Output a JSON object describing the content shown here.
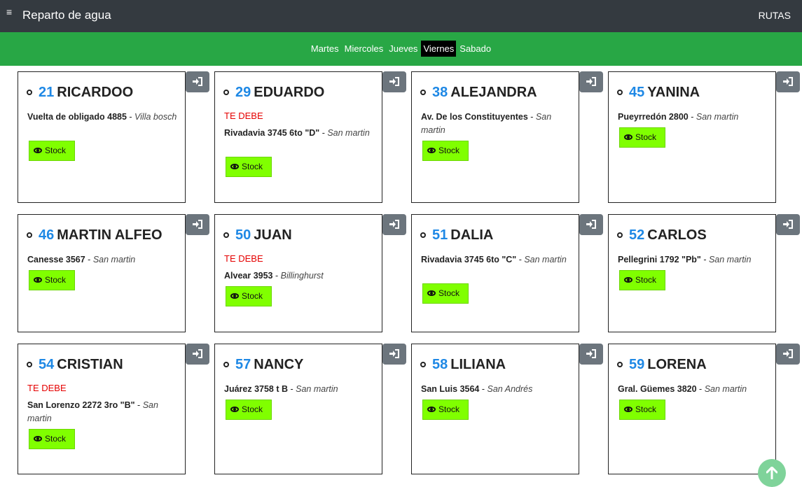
{
  "header": {
    "menu_icon": "hamburger-icon",
    "title": "Reparto de agua",
    "rutas_label": "RUTAS"
  },
  "days": {
    "items": [
      {
        "label": "Martes"
      },
      {
        "label": "Miercoles"
      },
      {
        "label": "Jueves"
      },
      {
        "label": "Viernes"
      },
      {
        "label": "Sabado"
      }
    ],
    "active": "Viernes"
  },
  "colors": {
    "topbar": "#343a40",
    "daybar": "#28a745",
    "number": "#1e88e5",
    "debe": "#e50000",
    "stock_button": "#80ff00",
    "login_button": "#6c757d"
  },
  "stock_label": "Stock",
  "debe_label": "TE DEBE",
  "clients": [
    {
      "number": "21",
      "name": "RICARDOO",
      "debe": false,
      "street": "Vuelta de obligado 4885",
      "city": "Villa bosch"
    },
    {
      "number": "29",
      "name": "EDUARDO",
      "debe": true,
      "street": "Rivadavia 3745 6to \"D\"",
      "city": "San martin"
    },
    {
      "number": "38",
      "name": "ALEJANDRA",
      "debe": false,
      "street": "Av. De los Constituyentes",
      "city": "San martin"
    },
    {
      "number": "45",
      "name": "YANINA",
      "debe": false,
      "street": "Pueyrredón 2800",
      "city": "San martin"
    },
    {
      "number": "46",
      "name": "MARTIN ALFEO",
      "debe": false,
      "street": "Canesse 3567",
      "city": "San martin"
    },
    {
      "number": "50",
      "name": "JUAN",
      "debe": true,
      "street": "Alvear 3953",
      "city": "Billinghurst"
    },
    {
      "number": "51",
      "name": "DALIA",
      "debe": false,
      "street": "Rivadavia 3745 6to \"C\"",
      "city": "San martin"
    },
    {
      "number": "52",
      "name": "CARLOS",
      "debe": false,
      "street": "Pellegrini 1792 \"Pb\"",
      "city": "San martin"
    },
    {
      "number": "54",
      "name": "CRISTIAN",
      "debe": true,
      "street": "San Lorenzo 2272 3ro \"B\"",
      "city": "San martin"
    },
    {
      "number": "57",
      "name": "NANCY",
      "debe": false,
      "street": "Juárez 3758 t B",
      "city": "San martin"
    },
    {
      "number": "58",
      "name": "LILIANA",
      "debe": false,
      "street": "San Luis 3564",
      "city": "San Andrés"
    },
    {
      "number": "59",
      "name": "LORENA",
      "debe": false,
      "street": "Gral. Güemes 3820",
      "city": "San martin"
    }
  ]
}
